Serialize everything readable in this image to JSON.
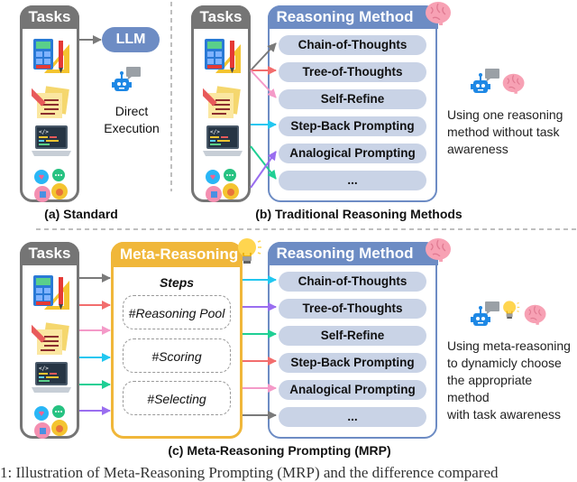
{
  "panel_a": {
    "tasks_title": "Tasks",
    "task_icons": [
      "calculator-ruler-icon",
      "notes-pencil-icon",
      "laptop-code-icon",
      "chat-bubbles-icon"
    ],
    "llm_label": "LLM",
    "robot_icon": "robot-icon",
    "execution_line1": "Direct",
    "execution_line2": "Execution",
    "caption": "(a) Standard"
  },
  "panel_b": {
    "tasks_title": "Tasks",
    "method_title": "Reasoning Method",
    "methods": [
      "Chain-of-Thoughts",
      "Tree-of-Thoughts",
      "Self-Refine",
      "Step-Back Prompting",
      "Analogical Prompting",
      "..."
    ],
    "description": "Using one reasoning method without task awareness",
    "caption": "(b) Traditional Reasoning Methods",
    "arrow_colors": [
      "#7a7a7a",
      "#f26d6d",
      "#f49ac8",
      "#22c7f0",
      "#1fcf94",
      "#9a6ef0"
    ]
  },
  "panel_c": {
    "tasks_title": "Tasks",
    "meta_title": "Meta-Reasoning",
    "steps_label": "Steps",
    "steps": [
      "#Reasoning Pool",
      "#Scoring",
      "#Selecting"
    ],
    "method_title": "Reasoning Method",
    "methods": [
      "Chain-of-Thoughts",
      "Tree-of-Thoughts",
      "Self-Refine",
      "Step-Back Prompting",
      "Analogical Prompting",
      "..."
    ],
    "description_line1": "Using meta-reasoning",
    "description_line2": "to dynamicly choose",
    "description_line3": "the appropriate method",
    "description_line4": "with task awareness",
    "caption": "(c) Meta-Reasoning Prompting (MRP)",
    "in_arrow_colors": [
      "#7a7a7a",
      "#f26d6d",
      "#f49ac8",
      "#22c7f0",
      "#1fcf94",
      "#9a6ef0"
    ],
    "out_arrow_colors": [
      "#22c7f0",
      "#9a6ef0",
      "#1fcf94",
      "#f26d6d",
      "#f49ac8",
      "#7a7a7a"
    ]
  },
  "footer": {
    "partial_caption": "1: Illustration of Meta-Reasoning Prompting (MRP) and the difference compared"
  },
  "colors": {
    "tasks_gray": "#757575",
    "method_blue": "#6d8cc4",
    "pill_blue": "#c9d3e6",
    "meta_yellow": "#f0b73a"
  }
}
